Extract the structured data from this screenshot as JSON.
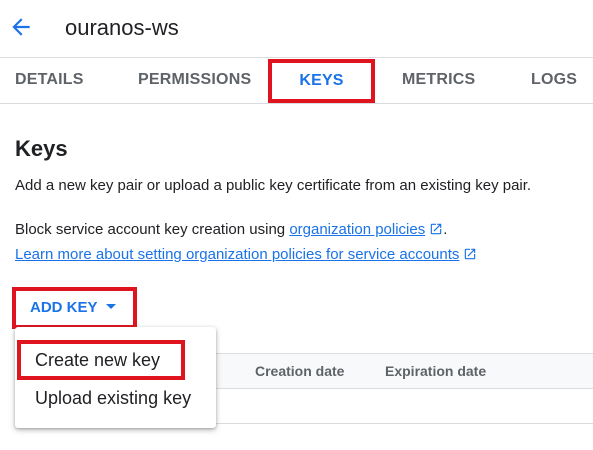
{
  "header": {
    "back_icon": "arrow-left-icon",
    "title": "ouranos-ws"
  },
  "tabs": [
    {
      "label": "DETAILS"
    },
    {
      "label": "PERMISSIONS"
    },
    {
      "label": "KEYS",
      "active": true
    },
    {
      "label": "METRICS"
    },
    {
      "label": "LOGS"
    }
  ],
  "keys": {
    "title": "Keys",
    "description": "Add a new key pair or upload a public key certificate from an existing key pair.",
    "block_prefix": "Block service account key creation using ",
    "block_link": "organization policies",
    "block_suffix": ".",
    "learn_more_link": "Learn more about setting organization policies for service accounts",
    "external_icon": "open-in-new-icon",
    "add_key_label": "ADD KEY",
    "add_key_icon": "caret-down-icon"
  },
  "table": {
    "columns": [
      "Creation date",
      "Expiration date"
    ]
  },
  "menu": {
    "items": [
      {
        "label": "Create new key",
        "highlighted": true
      },
      {
        "label": "Upload existing key"
      }
    ]
  },
  "colors": {
    "accent": "#1a73e8",
    "highlight_box": "#e0141e",
    "muted_text": "#5f6368"
  }
}
